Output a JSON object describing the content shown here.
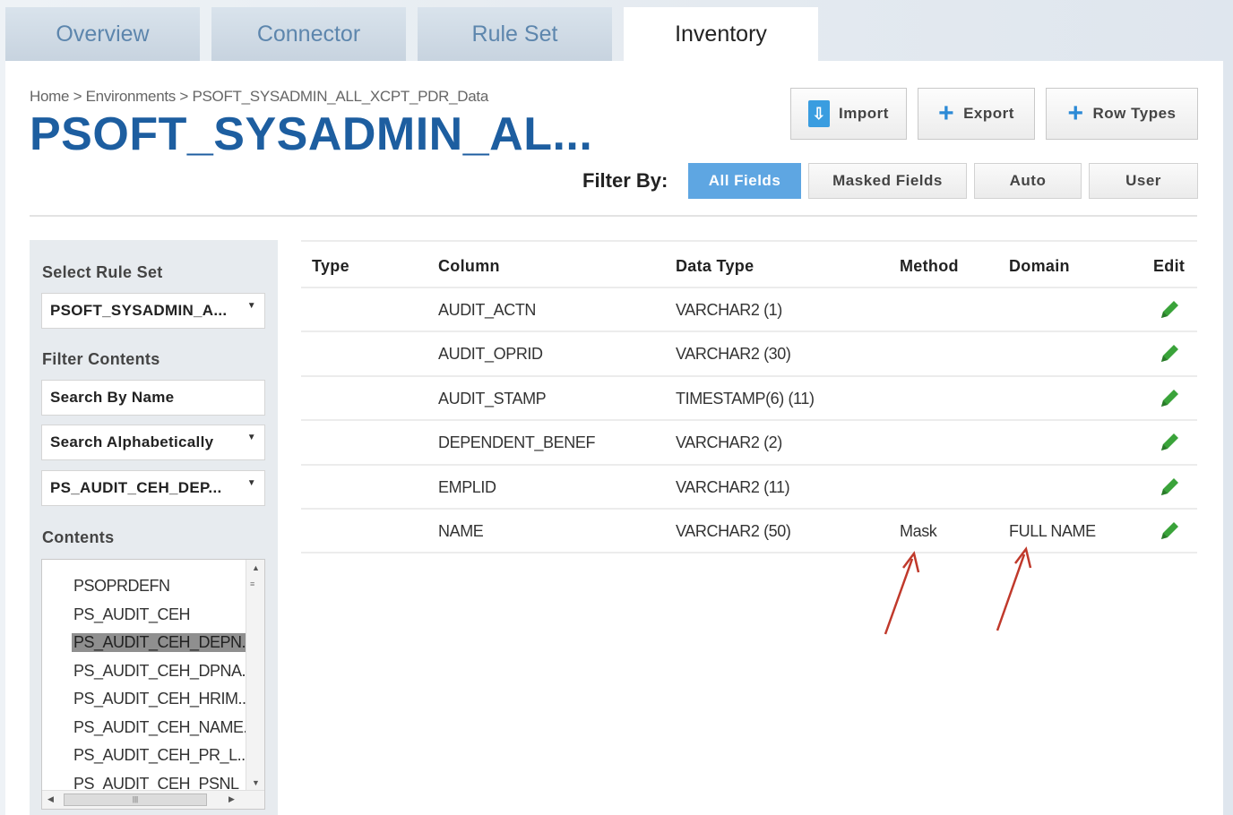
{
  "tabs": [
    "Overview",
    "Connector",
    "Rule Set",
    "Inventory"
  ],
  "breadcrumb": {
    "home": "Home",
    "sep1": " > ",
    "environments": "Environments",
    "sep2": " > ",
    "current": "PSOFT_SYSADMIN_ALL_XCPT_PDR_Data"
  },
  "title": "PSOFT_SYSADMIN_AL...",
  "toolbar": {
    "import_label": "Import",
    "export_label": "Export",
    "row_types_label": "Row Types"
  },
  "filter": {
    "label": "Filter By:",
    "options": [
      "All Fields",
      "Masked Fields",
      "Auto",
      "User"
    ],
    "active": "All Fields"
  },
  "sidebar": {
    "rule_set_label": "Select Rule Set",
    "rule_set_value": "PSOFT_SYSADMIN_A...",
    "filter_label": "Filter Contents",
    "search_placeholder": "Search By Name",
    "alpha_value": "Search Alphabetically",
    "table_value": "PS_AUDIT_CEH_DEP...",
    "contents_label": "Contents",
    "contents": [
      "PSOPRDEFN",
      "PS_AUDIT_CEH",
      "PS_AUDIT_CEH_DEPN..",
      "PS_AUDIT_CEH_DPNA..",
      "PS_AUDIT_CEH_HRIM...",
      "PS_AUDIT_CEH_NAME.",
      "PS_AUDIT_CEH_PR_L...",
      "PS_AUDIT_CEH_PSNL"
    ],
    "selected_index": 2
  },
  "table": {
    "headers": [
      "Type",
      "Column",
      "Data Type",
      "Method",
      "Domain",
      "Edit"
    ],
    "rows": [
      {
        "type": "",
        "column": "AUDIT_ACTN",
        "data_type": "VARCHAR2 (1)",
        "method": "",
        "domain": ""
      },
      {
        "type": "",
        "column": "AUDIT_OPRID",
        "data_type": "VARCHAR2 (30)",
        "method": "",
        "domain": ""
      },
      {
        "type": "",
        "column": "AUDIT_STAMP",
        "data_type": "TIMESTAMP(6) (11)",
        "method": "",
        "domain": ""
      },
      {
        "type": "",
        "column": "DEPENDENT_BENEF",
        "data_type": "VARCHAR2 (2)",
        "method": "",
        "domain": ""
      },
      {
        "type": "",
        "column": "EMPLID",
        "data_type": "VARCHAR2 (11)",
        "method": "",
        "domain": ""
      },
      {
        "type": "",
        "column": "NAME",
        "data_type": "VARCHAR2 (50)",
        "method": "Mask",
        "domain": "FULL NAME"
      }
    ]
  },
  "colors": {
    "accent": "#5ea6e2",
    "title": "#1d5ea0",
    "edit_icon": "#3aa33a",
    "arrow": "#c0392b"
  }
}
